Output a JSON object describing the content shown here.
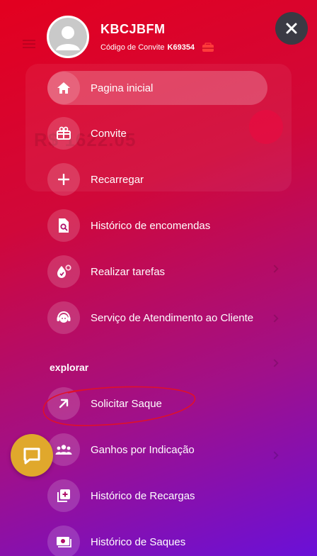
{
  "user": {
    "name": "KBCJBFM",
    "invite_label": "Código de Convite",
    "invite_code": "K69354"
  },
  "background": {
    "balance": "R$ 1622.05"
  },
  "menu": {
    "items": [
      {
        "label": "Pagina inicial",
        "icon": "home-icon"
      },
      {
        "label": "Convite",
        "icon": "gift-icon"
      },
      {
        "label": "Recarregar",
        "icon": "plus-icon"
      },
      {
        "label": "Histórico de encomendas",
        "icon": "document-search-icon"
      },
      {
        "label": "Realizar tarefas",
        "icon": "tasks-icon"
      },
      {
        "label": "Serviço de Atendimento ao Cliente",
        "icon": "support-agent-icon"
      }
    ],
    "section_title": "explorar",
    "explore_items": [
      {
        "label": "Solicitar Saque",
        "icon": "arrow-up-right-icon"
      },
      {
        "label": "Ganhos por Indicação",
        "icon": "group-icon"
      },
      {
        "label": "Histórico de Recargas",
        "icon": "add-box-icon"
      },
      {
        "label": "Histórico de Saques",
        "icon": "money-icon"
      }
    ]
  },
  "colors": {
    "gradient_start": "#e3001f",
    "gradient_end": "#6a10d8",
    "close_button": "#3a3a44",
    "chat_button": "#e0a82c",
    "annotation": "#e0102a"
  }
}
